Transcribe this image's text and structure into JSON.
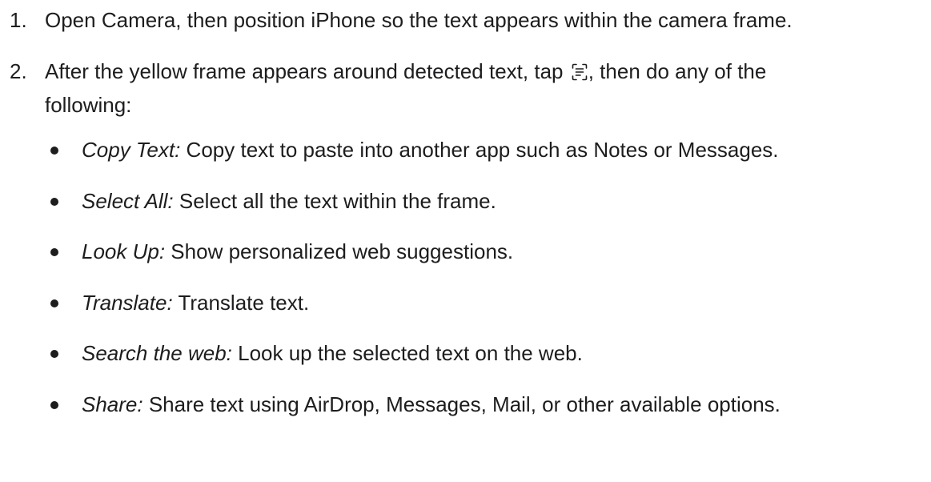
{
  "steps": [
    {
      "number": "1.",
      "text": "Open Camera, then position iPhone so the text appears within the camera frame."
    },
    {
      "number": "2.",
      "text_before": "After the yellow frame appears around detected text, tap",
      "icon": "live-text-icon",
      "text_after": ", then do any of the following:"
    }
  ],
  "options": [
    {
      "term": "Copy Text:",
      "desc": " Copy text to paste into another app such as Notes or Messages."
    },
    {
      "term": "Select All:",
      "desc": " Select all the text within the frame."
    },
    {
      "term": "Look Up:",
      "desc": " Show personalized web suggestions."
    },
    {
      "term": "Translate:",
      "desc": " Translate text."
    },
    {
      "term": "Search the web:",
      "desc": " Look up the selected text on the web."
    },
    {
      "term": "Share:",
      "desc": " Share text using AirDrop, Messages, Mail, or other available options."
    }
  ]
}
